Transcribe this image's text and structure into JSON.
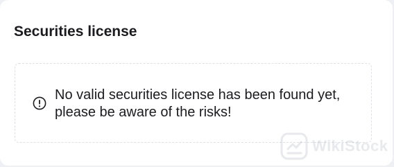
{
  "section": {
    "title": "Securities license"
  },
  "notice": {
    "icon": "exclamation-circle-icon",
    "message": "No valid securities license has been found yet, please be aware of the risks!"
  },
  "watermark": {
    "text": "WikiStock"
  },
  "colors": {
    "text": "#1b1b1f",
    "dashed_border": "#dde0e6",
    "card_background": "#ffffff"
  }
}
